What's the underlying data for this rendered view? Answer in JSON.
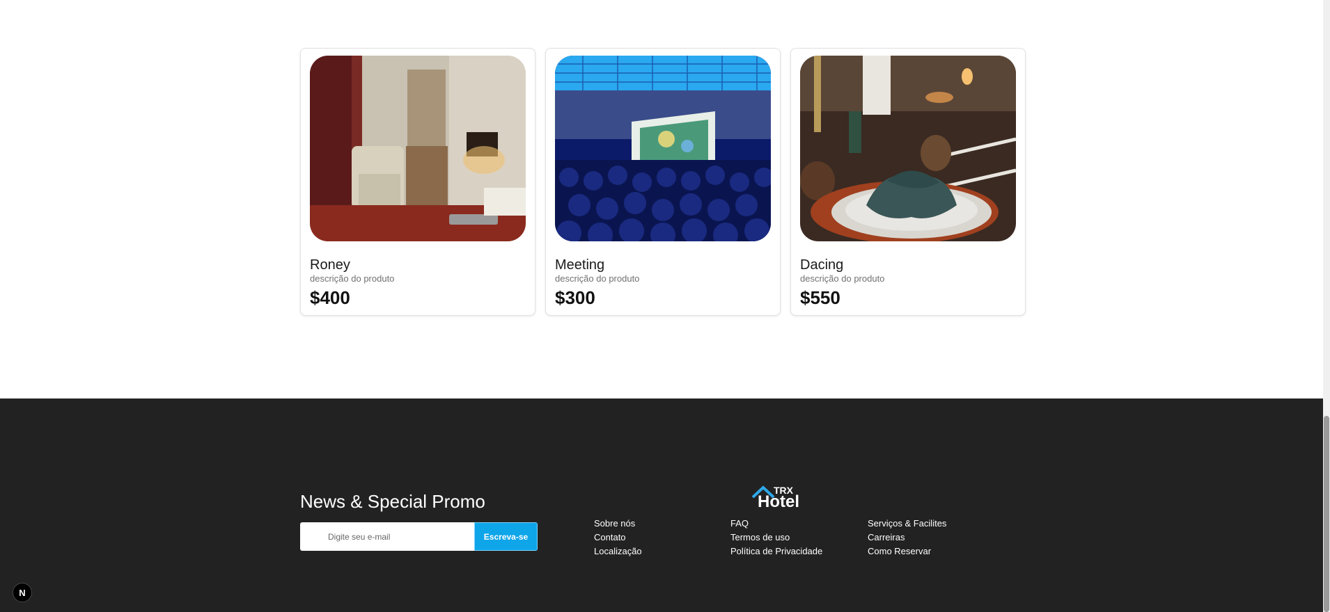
{
  "cards": [
    {
      "title": "Roney",
      "description": "descrição do produto",
      "price": "$400",
      "image": "hotel-room-photo"
    },
    {
      "title": "Meeting",
      "description": "descrição do produto",
      "price": "$300",
      "image": "conference-audience-photo"
    },
    {
      "title": "Dacing",
      "description": "descrição do produto",
      "price": "$550",
      "image": "dinner-table-setting-photo"
    }
  ],
  "footer": {
    "promo_title": "News & Special Promo",
    "email_placeholder": "Digite seu e-mail",
    "subscribe_label": "Escreva-se",
    "logo_small": "TRX",
    "logo_big": "Hotel",
    "columns": [
      [
        "Sobre nós",
        "Contato",
        "Localização"
      ],
      [
        "FAQ",
        "Termos de uso",
        "Política de Privacidade"
      ],
      [
        "Serviços & Facilites",
        "Carreiras",
        "Como Reservar"
      ]
    ]
  },
  "dev_badge": "N",
  "colors": {
    "footer_bg": "#222222",
    "accent": "#0ea5e9"
  }
}
